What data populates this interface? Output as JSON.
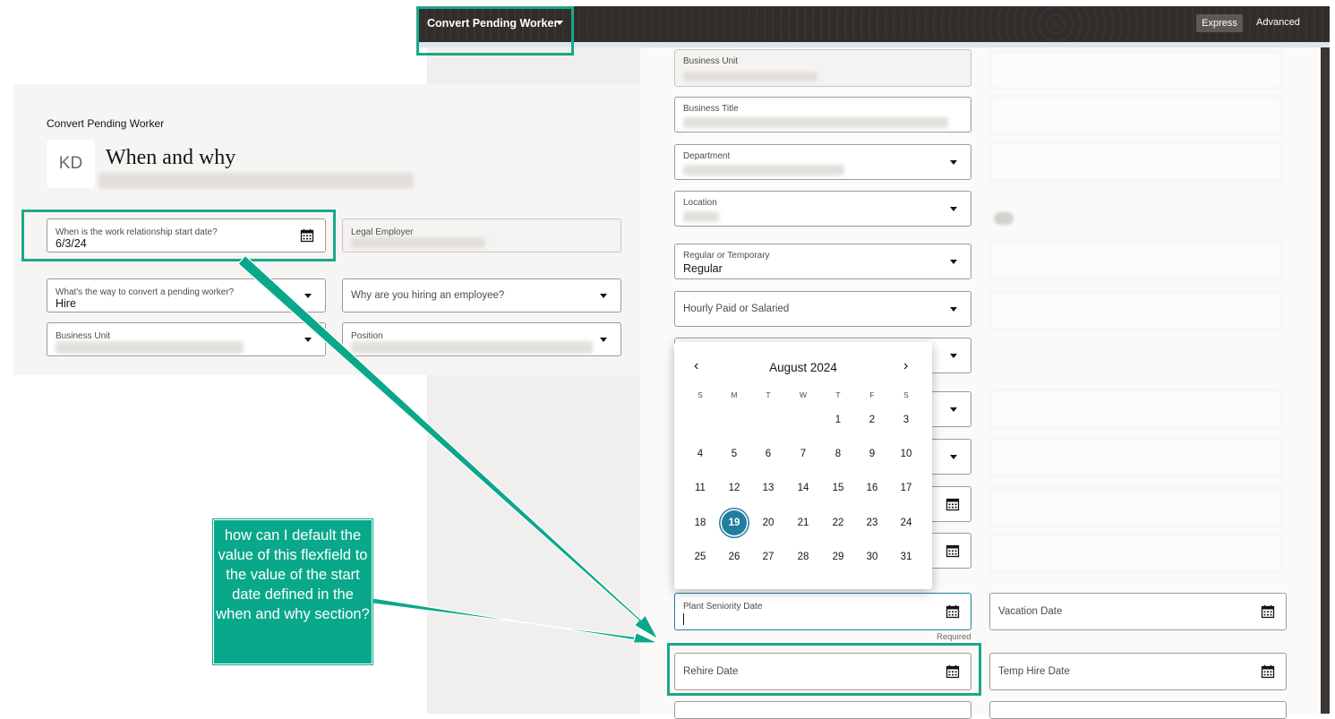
{
  "topbar": {
    "title": "Convert Pending Worker",
    "express": "Express",
    "advanced": "Advanced"
  },
  "page": {
    "eyebrow": "Convert Pending Worker",
    "avatar": "KD",
    "title": "When and why"
  },
  "when_and_why": {
    "start_date_label": "When is the work relationship start date?",
    "start_date_value": "6/3/24",
    "legal_employer_label": "Legal Employer",
    "convert_way_label": "What's the way to convert a pending worker?",
    "convert_way_value": "Hire",
    "why_hiring_placeholder": "Why are you hiring an employee?",
    "business_unit_label": "Business Unit",
    "position_label": "Position"
  },
  "assignment": {
    "business_unit_label": "Business Unit",
    "business_title_label": "Business Title",
    "department_label": "Department",
    "location_label": "Location",
    "regular_temporary_label": "Regular or Temporary",
    "regular_temporary_value": "Regular",
    "hourly_salaried_placeholder": "Hourly Paid or Salaried",
    "plant_seniority_label": "Plant Seniority Date",
    "required_text": "Required",
    "vacation_date_label": "Vacation Date",
    "rehire_date_label": "Rehire Date",
    "temp_hire_date_label": "Temp Hire Date"
  },
  "datepicker": {
    "month_label": "August 2024",
    "weekdays": [
      "S",
      "M",
      "T",
      "W",
      "T",
      "F",
      "S"
    ],
    "first_weekday_index": 4,
    "days_in_month": 31,
    "selected_day": 19,
    "prev_label": "‹",
    "next_label": "›"
  },
  "annotation": {
    "callout": "how can I default the value of this flexfield to the value of the start date defined in the when and why section?"
  },
  "colors": {
    "accent": "#227e9e",
    "annotation": "#1aa889",
    "topbar": "#312d2a"
  }
}
